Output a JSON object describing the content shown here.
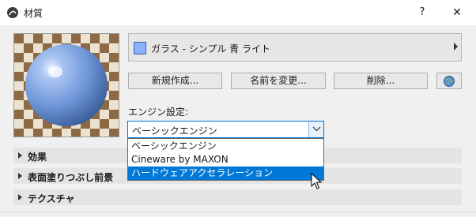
{
  "window": {
    "title": "材質",
    "help_label": "?",
    "close_label": "✕"
  },
  "material": {
    "name": "ガラス - シンプル 青 ライト",
    "swatch_color": "#8ab4ff"
  },
  "buttons": {
    "new": "新規作成...",
    "rename": "名前を変更...",
    "delete": "削除..."
  },
  "engine": {
    "label": "エンジン設定:",
    "selected": "ベーシックエンジン",
    "options": [
      "ベーシックエンジン",
      "Cineware by MAXON",
      "ハードウェアアクセラレーション"
    ],
    "highlighted_index": 2
  },
  "sections": [
    "効果",
    "表面塗りつぶし前景",
    "テクスチャ"
  ]
}
